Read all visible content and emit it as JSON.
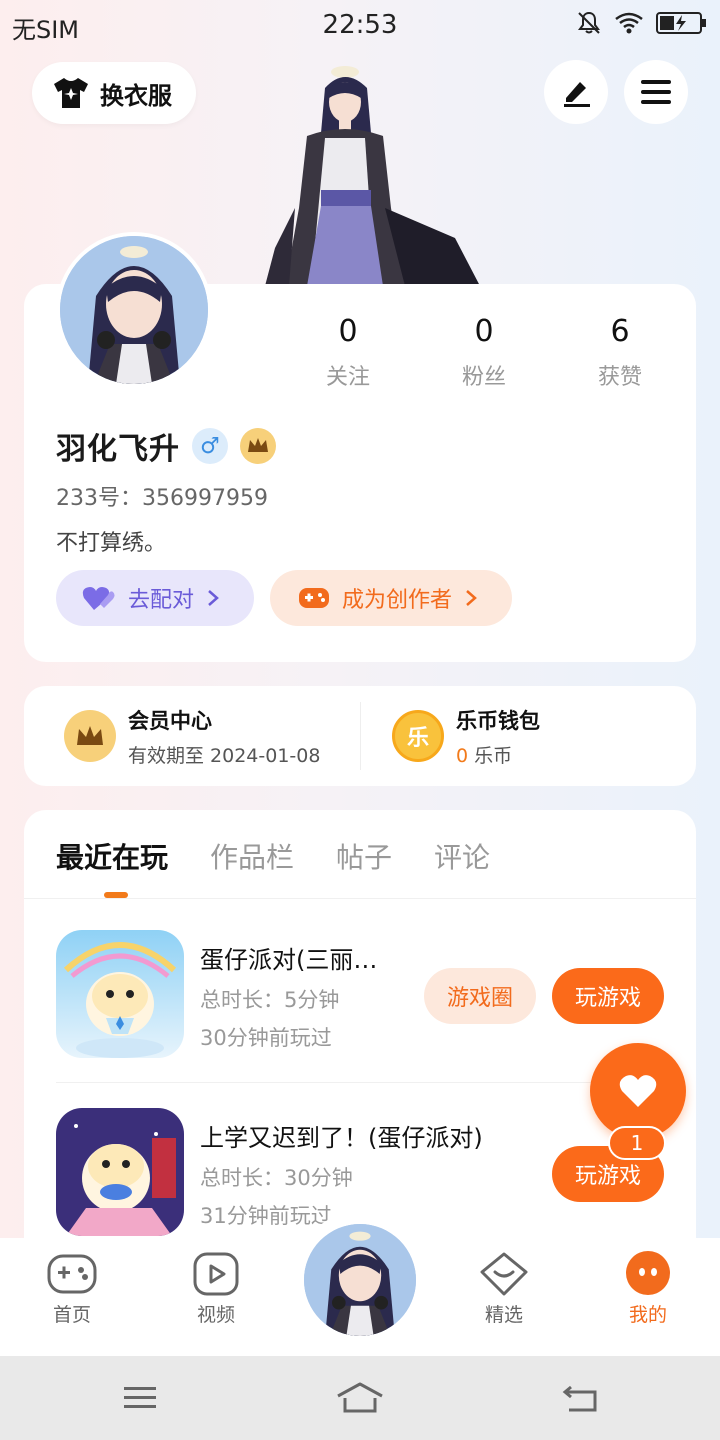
{
  "status_bar": {
    "carrier": "无SIM",
    "time": "22:53"
  },
  "header": {
    "outfit_label": "换衣服"
  },
  "profile": {
    "stats": [
      {
        "value": "0",
        "label": "关注"
      },
      {
        "value": "0",
        "label": "粉丝"
      },
      {
        "value": "6",
        "label": "获赞"
      }
    ],
    "username": "羽化飞升",
    "gender_symbol": "♂",
    "user_id": "233号：356997959",
    "bio": "不打算绣。",
    "match_label": "去配对",
    "creator_label": "成为创作者"
  },
  "vip": {
    "title": "会员中心",
    "expiry": "有效期至 2024-01-08",
    "wallet_title": "乐币钱包",
    "wallet_icon_char": "乐",
    "wallet_amount": "0",
    "wallet_unit": " 乐币"
  },
  "tabs": [
    "最近在玩",
    "作品栏",
    "帖子",
    "评论"
  ],
  "games": [
    {
      "title": "蛋仔派对(三丽…",
      "duration": "总时长：5分钟",
      "last_played": "30分钟前玩过",
      "community_label": "游戏圈",
      "play_label": "玩游戏"
    },
    {
      "title": "上学又迟到了！(蛋仔派对)",
      "duration": "总时长：30分钟",
      "last_played": "31分钟前玩过",
      "play_label": "玩游戏"
    }
  ],
  "fab": {
    "count": "1"
  },
  "bottom_nav": [
    {
      "label": "首页",
      "icon": "gamepad-icon"
    },
    {
      "label": "视频",
      "icon": "video-icon"
    },
    {
      "label": "精选",
      "icon": "heart-box-icon"
    },
    {
      "label": "我的",
      "icon": "profile-face-icon",
      "active": true
    }
  ],
  "colors": {
    "accent": "#fb6a1a",
    "match": "#6a5bd8",
    "gender": "#3a8de0"
  }
}
